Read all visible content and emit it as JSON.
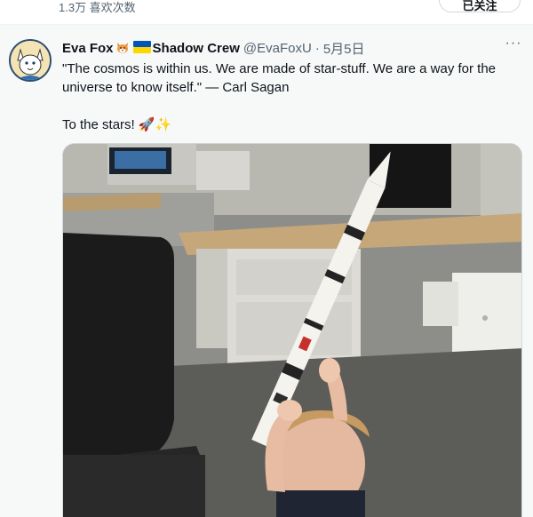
{
  "previous": {
    "likes_stat": "1.3万 喜欢次数",
    "button_label": "已关注"
  },
  "tweet": {
    "author": {
      "display_name": "Eva Fox",
      "community": "Shadow Crew",
      "handle": "@EvaFoxU",
      "separator": "·",
      "date": "5月5日",
      "avatar_icon": "fox-avatar-icon",
      "badge_icons": [
        "fox-emoji-icon",
        "ukraine-flag-icon"
      ]
    },
    "more_label": "···",
    "text_line_1": "\"The cosmos is within us. We are made of star-stuff. We are a way for the universe to know itself.\" — Carl Sagan",
    "text_line_2": "To the stars! 🚀✨",
    "media_icon": "photo-child-holding-rocket-model"
  },
  "colors": {
    "card_bg": "#f7f9f9",
    "text": "#0f1419",
    "muted": "#536471",
    "flag_blue": "#0057b7",
    "flag_yellow": "#ffd700"
  }
}
